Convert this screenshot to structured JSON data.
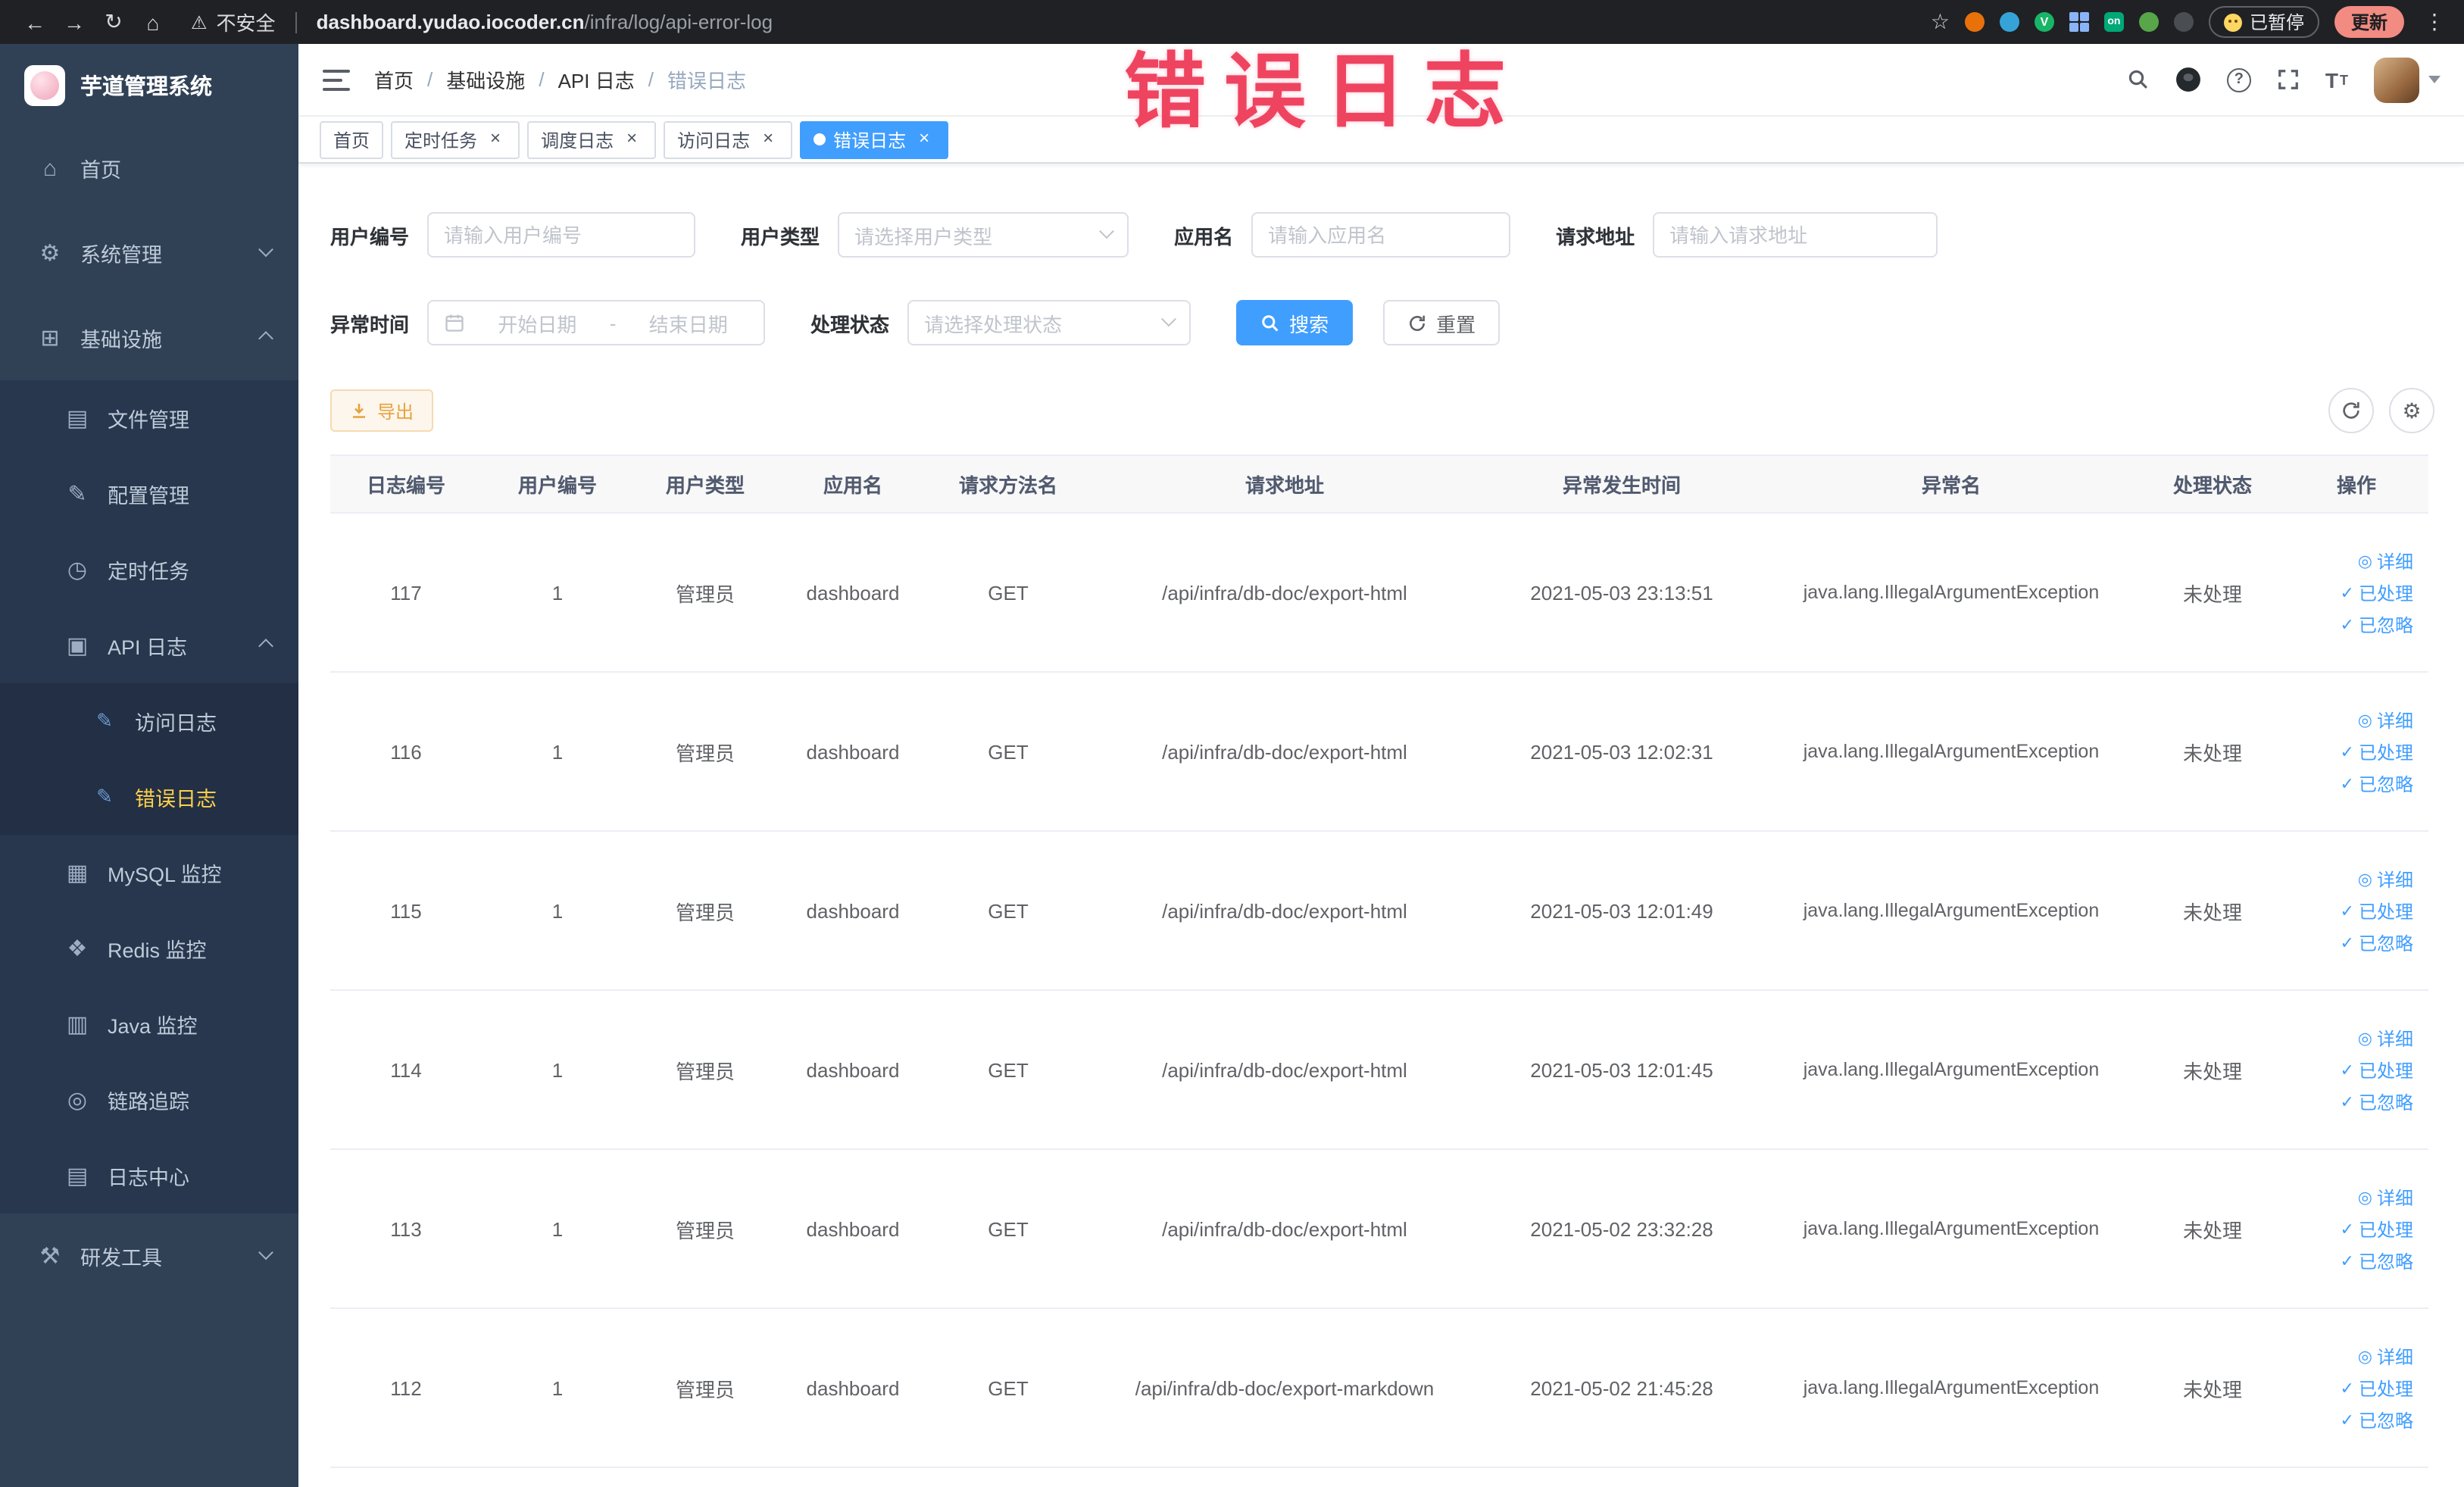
{
  "browser": {
    "security_label": "不安全",
    "url_host": "dashboard.yudao.iocoder.cn",
    "url_path": "/infra/log/api-error-log",
    "paused_label": "已暂停",
    "update_label": "更新",
    "ext_v_label": "V",
    "ext_on_label": "on"
  },
  "overlay": {
    "title": "错误日志"
  },
  "sidebar": {
    "logo_title": "芋道管理系统",
    "items": [
      {
        "label": "首页"
      },
      {
        "label": "系统管理"
      },
      {
        "label": "基础设施"
      },
      {
        "label": "文件管理"
      },
      {
        "label": "配置管理"
      },
      {
        "label": "定时任务"
      },
      {
        "label": "API 日志"
      },
      {
        "label": "访问日志"
      },
      {
        "label": "错误日志"
      },
      {
        "label": "MySQL 监控"
      },
      {
        "label": "Redis 监控"
      },
      {
        "label": "Java 监控"
      },
      {
        "label": "链路追踪"
      },
      {
        "label": "日志中心"
      },
      {
        "label": "研发工具"
      }
    ]
  },
  "header": {
    "breadcrumb": {
      "separator": "/",
      "items": [
        "首页",
        "基础设施",
        "API 日志",
        "错误日志"
      ]
    }
  },
  "tabs": [
    {
      "label": "首页"
    },
    {
      "label": "定时任务"
    },
    {
      "label": "调度日志"
    },
    {
      "label": "访问日志"
    },
    {
      "label": "错误日志"
    }
  ],
  "filters": {
    "user_id_label": "用户编号",
    "user_id_placeholder": "请输入用户编号",
    "user_type_label": "用户类型",
    "user_type_placeholder": "请选择用户类型",
    "app_label": "应用名",
    "app_placeholder": "请输入应用名",
    "url_label": "请求地址",
    "url_placeholder": "请输入请求地址",
    "time_label": "异常时间",
    "time_start_placeholder": "开始日期",
    "time_separator": "-",
    "time_end_placeholder": "结束日期",
    "status_label": "处理状态",
    "status_placeholder": "请选择处理状态",
    "search_label": "搜索",
    "reset_label": "重置"
  },
  "toolbar": {
    "export_label": "导出"
  },
  "table": {
    "columns": [
      "日志编号",
      "用户编号",
      "用户类型",
      "应用名",
      "请求方法名",
      "请求地址",
      "异常发生时间",
      "异常名",
      "处理状态",
      "操作"
    ],
    "actions": {
      "detail": "详细",
      "processed": "已处理",
      "ignored": "已忽略"
    },
    "rows": [
      {
        "id": "117",
        "user_id": "1",
        "user_type": "管理员",
        "app": "dashboard",
        "method": "GET",
        "url": "/api/infra/db-doc/export-html",
        "time": "2021-05-03 23:13:51",
        "exception": "java.lang.IllegalArgumentException",
        "status": "未处理"
      },
      {
        "id": "116",
        "user_id": "1",
        "user_type": "管理员",
        "app": "dashboard",
        "method": "GET",
        "url": "/api/infra/db-doc/export-html",
        "time": "2021-05-03 12:02:31",
        "exception": "java.lang.IllegalArgumentException",
        "status": "未处理"
      },
      {
        "id": "115",
        "user_id": "1",
        "user_type": "管理员",
        "app": "dashboard",
        "method": "GET",
        "url": "/api/infra/db-doc/export-html",
        "time": "2021-05-03 12:01:49",
        "exception": "java.lang.IllegalArgumentException",
        "status": "未处理"
      },
      {
        "id": "114",
        "user_id": "1",
        "user_type": "管理员",
        "app": "dashboard",
        "method": "GET",
        "url": "/api/infra/db-doc/export-html",
        "time": "2021-05-03 12:01:45",
        "exception": "java.lang.IllegalArgumentException",
        "status": "未处理"
      },
      {
        "id": "113",
        "user_id": "1",
        "user_type": "管理员",
        "app": "dashboard",
        "method": "GET",
        "url": "/api/infra/db-doc/export-html",
        "time": "2021-05-02 23:32:28",
        "exception": "java.lang.IllegalArgumentException",
        "status": "未处理"
      },
      {
        "id": "112",
        "user_id": "1",
        "user_type": "管理员",
        "app": "dashboard",
        "method": "GET",
        "url": "/api/infra/db-doc/export-markdown",
        "time": "2021-05-02 21:45:28",
        "exception": "java.lang.IllegalArgumentException",
        "status": "未处理"
      }
    ]
  },
  "icons": {
    "back": "←",
    "forward": "→",
    "reload": "↻",
    "home": "⌂",
    "warning": "⚠",
    "star": "☆",
    "more": "⋮",
    "question": "?",
    "font_big": "T",
    "font_small": "T",
    "menu_home": "⌂",
    "menu_system": "⚙",
    "menu_infra": "⊞",
    "menu_file": "▤",
    "menu_config": "✎",
    "menu_job": "◷",
    "menu_apilog": "▣",
    "menu_access": "✎",
    "menu_error": "✎",
    "menu_mysql": "▦",
    "menu_redis": "❖",
    "menu_java": "▥",
    "menu_trace": "◎",
    "menu_logcenter": "▤",
    "menu_dev": "⚒",
    "close": "×",
    "gear": "⚙",
    "detail": "◎",
    "check": "✓"
  }
}
